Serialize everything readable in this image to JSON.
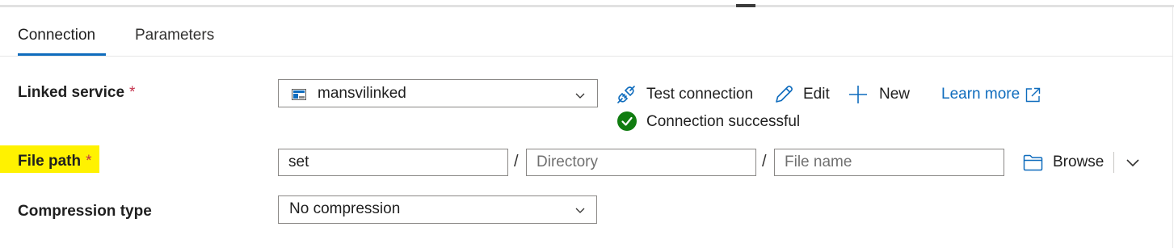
{
  "tabs": [
    {
      "label": "Connection",
      "active": true
    },
    {
      "label": "Parameters",
      "active": false
    }
  ],
  "linked_service": {
    "label": "Linked service",
    "required_mark": "*",
    "selected": "mansvilinked",
    "icon": "linked-service-icon"
  },
  "actions": {
    "test_connection": "Test connection",
    "edit": "Edit",
    "new": "New",
    "learn_more": "Learn more"
  },
  "status": {
    "text": "Connection successful",
    "color": "#107c10"
  },
  "file_path": {
    "label": "File path",
    "required_mark": "*",
    "container_value": "set",
    "directory_placeholder": "Directory",
    "directory_value": "",
    "file_name_placeholder": "File name",
    "file_name_value": "",
    "separator": "/",
    "browse": "Browse"
  },
  "compression": {
    "label": "Compression type",
    "selected": "No compression"
  },
  "colors": {
    "accent": "#0f6cbd",
    "required": "#c4314b",
    "highlight": "#fff200"
  }
}
